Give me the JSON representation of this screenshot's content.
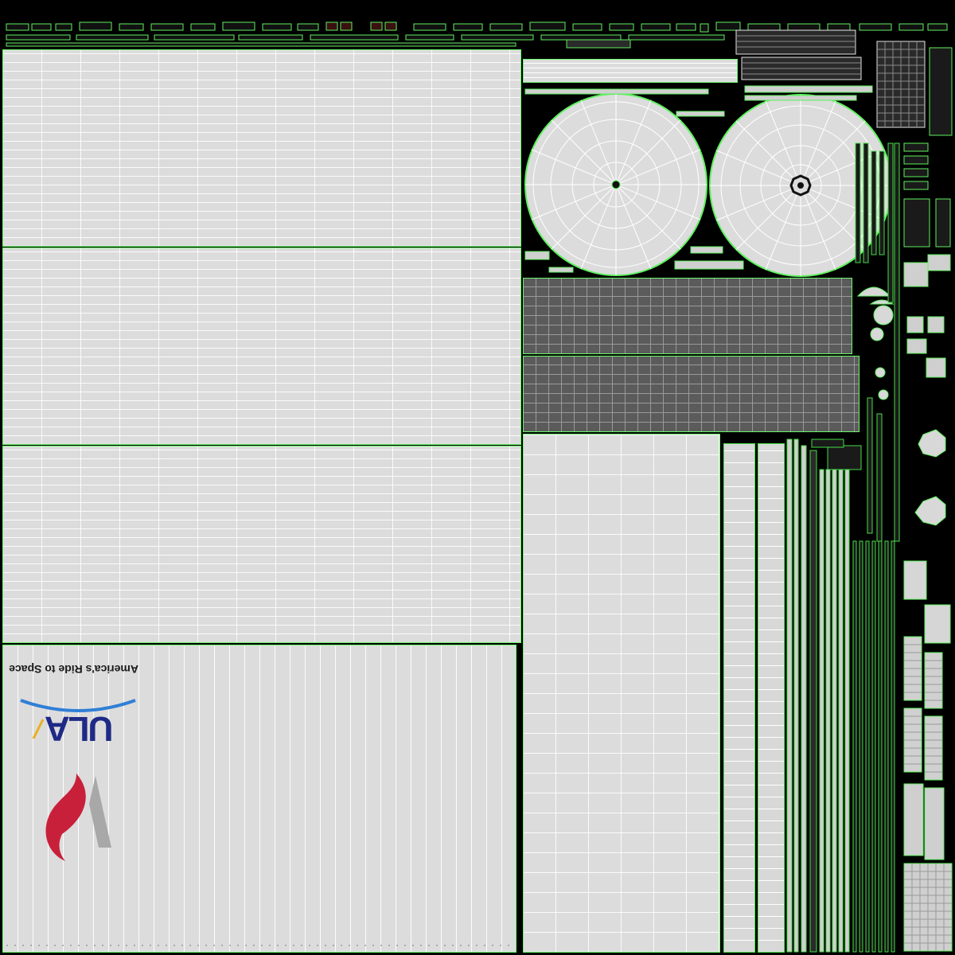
{
  "texture": {
    "tagline": "America's Ride to Space",
    "logo_text": "ULA",
    "colors": {
      "background": "#000000",
      "panel_fill": "#dcdcdc",
      "seam": "#6cf56c",
      "dark_panel": "#5b5b5b",
      "logo_blue": "#1e2a86",
      "logo_arc": "#2f7fd6",
      "logo_red": "#c8203a",
      "logo_gray": "#a8a8a8",
      "logo_gold": "#e8b020"
    }
  }
}
